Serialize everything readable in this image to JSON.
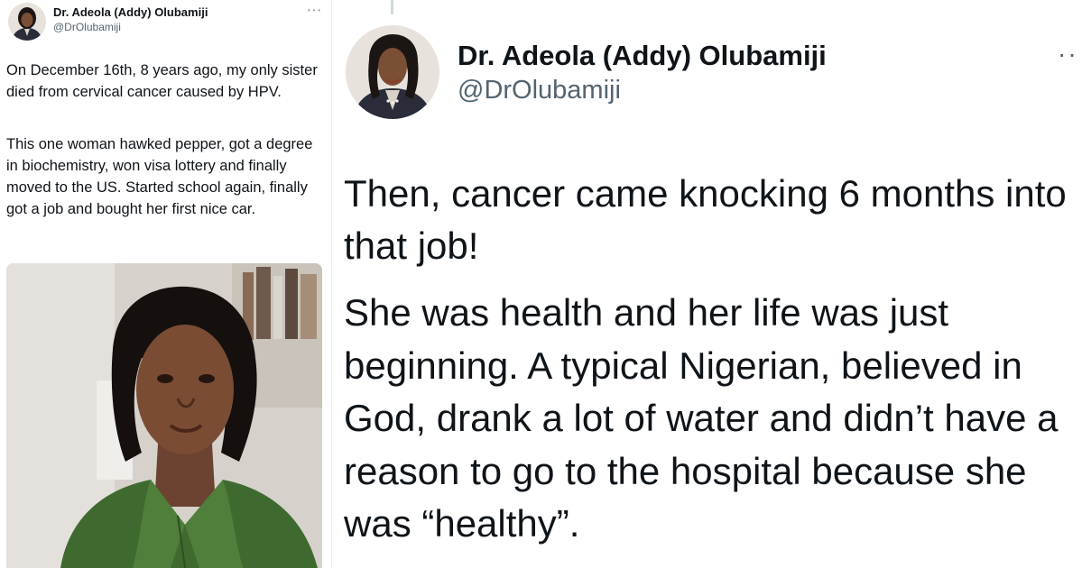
{
  "left_tweet": {
    "author_name": "Dr. Adeola (Addy) Olubamiji",
    "handle": "@DrOlubamiji",
    "more_glyph": "···",
    "paragraphs": [
      "On December 16th, 8 years ago, my only sister died from cervical cancer caused by HPV.",
      "This one woman hawked pepper, got a degree in biochemistry, won visa lottery and finally moved to the US. Started school again, finally got a job and bought her first nice car."
    ]
  },
  "right_tweet": {
    "author_name": "Dr. Adeola (Addy) Olubamiji",
    "handle": "@DrOlubamiji",
    "more_glyph": "··",
    "paragraphs": [
      "Then, cancer came knocking 6 months into that  job!",
      "She was health and her life was just beginning. A typical Nigerian, believed in God, drank a lot of water and didn’t have a reason to go to the hospital because she was “healthy”."
    ]
  },
  "colors": {
    "text_primary": "#0f1419",
    "text_secondary": "#536471",
    "thread_line": "#cfd9de"
  }
}
